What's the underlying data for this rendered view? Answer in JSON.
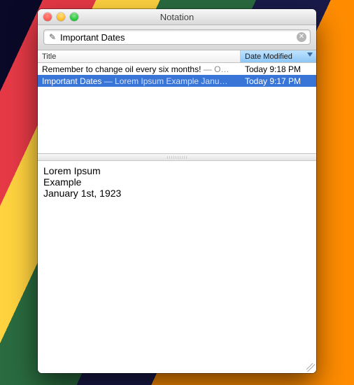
{
  "window": {
    "title": "Notation"
  },
  "search": {
    "value": "Important Dates",
    "icon": "pencil-icon",
    "clear_icon": "clear-icon"
  },
  "columns": {
    "title": "Title",
    "date": "Date Modified"
  },
  "notes": [
    {
      "title": "Remember to change oil every six months!",
      "preview_sep": " — ",
      "preview": "O…",
      "date": "Today  9:18 PM",
      "selected": false
    },
    {
      "title": "Important Dates",
      "preview_sep": " — ",
      "preview": "Lorem Ipsum  Example Janu…",
      "date": "Today  9:17 PM",
      "selected": true
    }
  ],
  "editor": {
    "content": "Lorem Ipsum\nExample\nJanuary 1st, 1923"
  }
}
